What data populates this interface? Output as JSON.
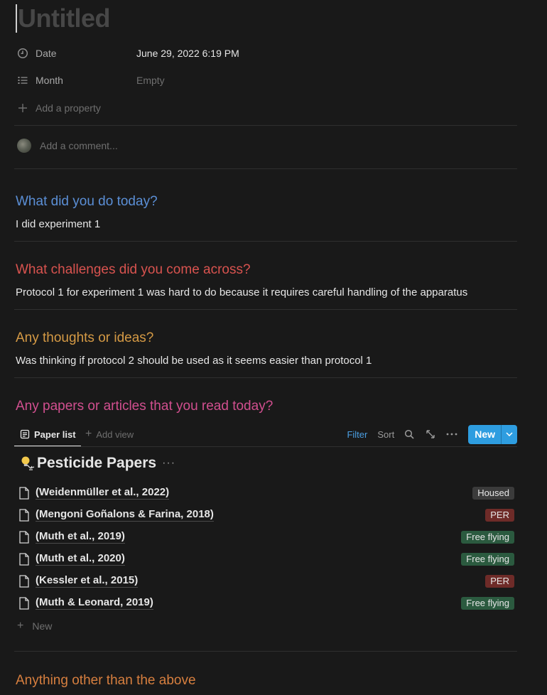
{
  "page": {
    "title": "Untitled"
  },
  "properties": [
    {
      "icon": "clock-icon",
      "label": "Date",
      "value": "June 29, 2022 6:19 PM"
    },
    {
      "icon": "list-icon",
      "label": "Month",
      "value": "Empty"
    }
  ],
  "add_property_label": "Add a property",
  "comment": {
    "placeholder": "Add a comment..."
  },
  "sections": {
    "did_today": {
      "heading": "What did you do today?",
      "body": "I did experiment 1"
    },
    "challenges": {
      "heading": "What challenges did you come across?",
      "body": "Protocol 1 for experiment 1 was hard to do because it requires careful handling of the apparatus"
    },
    "thoughts": {
      "heading": "Any thoughts or ideas?",
      "body": "Was thinking if protocol 2 should be used as it seems easier than protocol 1"
    },
    "papers": {
      "heading": "Any papers or articles that you read today?"
    },
    "other": {
      "heading": "Anything other than the above"
    }
  },
  "database": {
    "view_tab": "Paper list",
    "add_view": "Add view",
    "filter": "Filter",
    "sort": "Sort",
    "new_button": "New",
    "title": "Pesticide Papers",
    "more": "···",
    "rows": [
      {
        "name": "(Weidenmüller et al., 2022)",
        "tag": "Housed",
        "tag_color": "#3b3b3b"
      },
      {
        "name": "(Mengoni Goñalons & Farina, 2018)",
        "tag": "PER",
        "tag_color": "#6e2b28"
      },
      {
        "name": "(Muth et al., 2019)",
        "tag": "Free flying",
        "tag_color": "#2b5a3f"
      },
      {
        "name": "(Muth et al., 2020)",
        "tag": "Free flying",
        "tag_color": "#2b5a3f"
      },
      {
        "name": "(Kessler et al., 2015)",
        "tag": "PER",
        "tag_color": "#6e2b28"
      },
      {
        "name": "(Muth & Leonard, 2019)",
        "tag": "Free flying",
        "tag_color": "#2b5a3f"
      }
    ],
    "new_row": "New"
  },
  "colors": {
    "accent": "#2e9de0",
    "heading_blue": "#5b8fd6",
    "heading_red": "#d9534f",
    "heading_orange": "#d59a45",
    "heading_pink": "#d14f8f",
    "heading_orange2": "#d77f3f"
  }
}
